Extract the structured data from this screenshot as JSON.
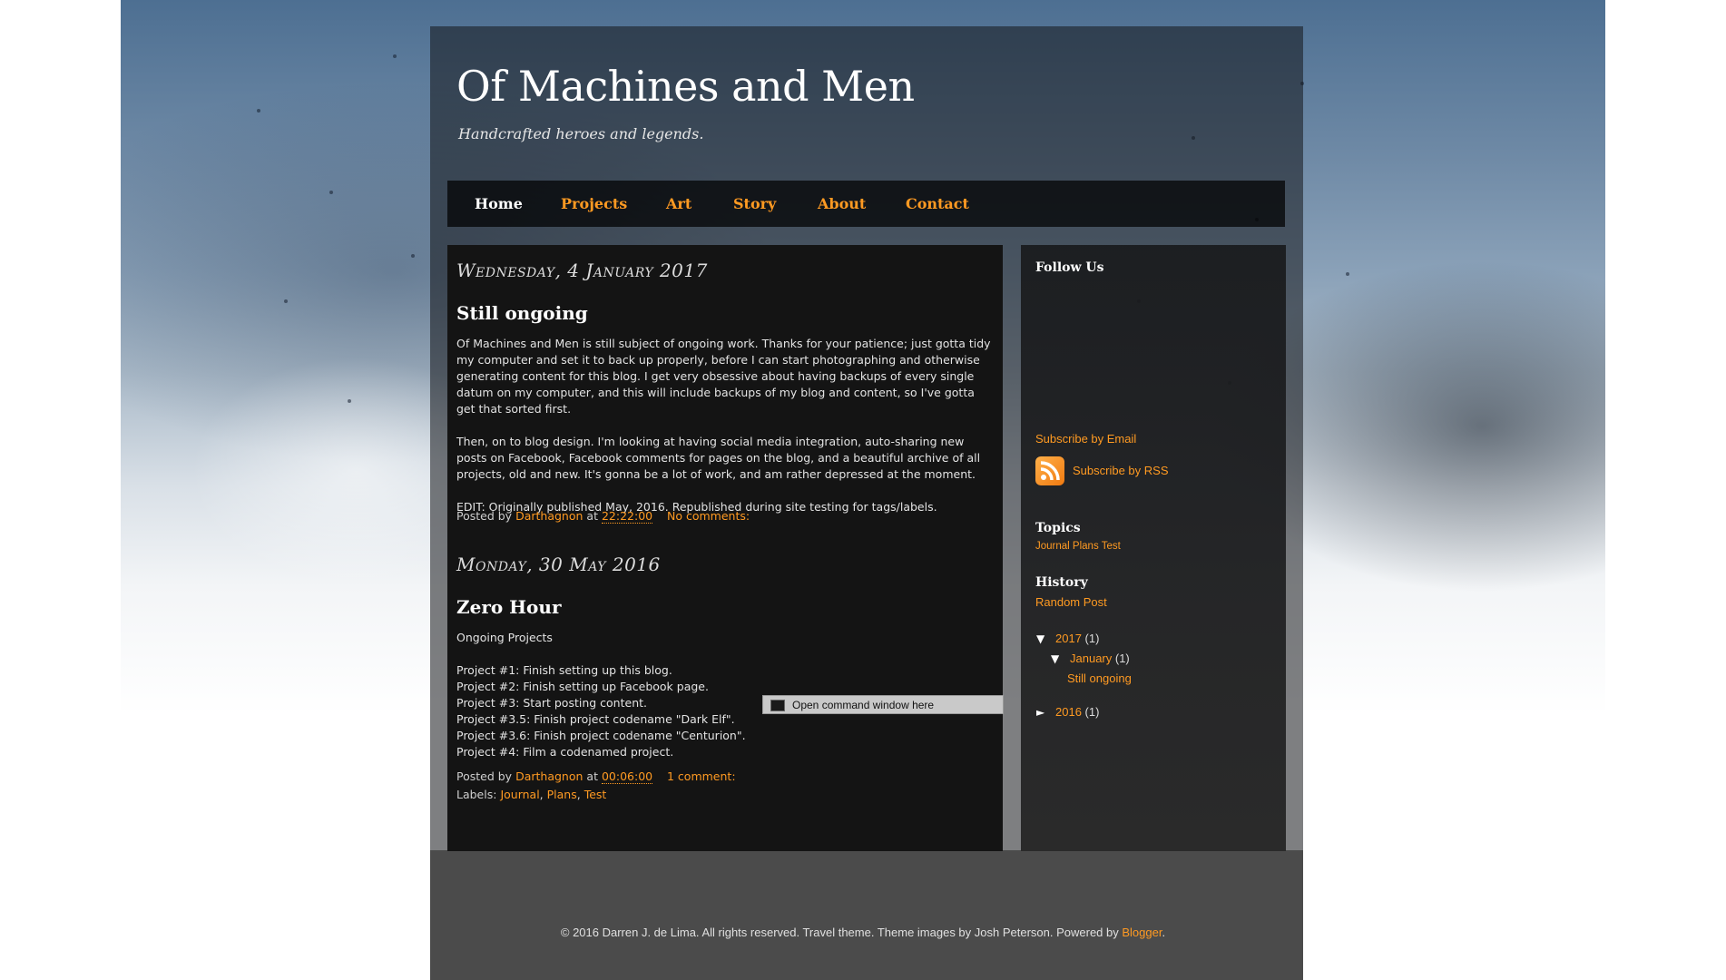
{
  "blog": {
    "title": "Of Machines and Men",
    "description": "Handcrafted heroes and legends."
  },
  "nav": {
    "items": [
      "Home",
      "Projects",
      "Art",
      "Story",
      "About",
      "Contact"
    ],
    "active": "Home"
  },
  "posts": [
    {
      "date": "Wednesday, 4 January 2017",
      "title": "Still ongoing",
      "paragraphs": [
        "Of Machines and Men is still subject of ongoing work. Thanks for your patience; just gotta tidy my computer and set it to back up properly, before I can start photographing and otherwise generating content for this blog. I get very obsessive about having backups of every single datum on my computer, and this will include backups of my blog and content, so I've gotta get that sorted first.",
        "Then, on to blog design. I'm looking at having social media integration, auto-sharing new posts on Facebook, Facebook comments for pages on the blog, and a beautiful archive of all projects, old and new. It's gonna be a lot of work, and am rather depressed at the moment.",
        "EDIT: Originally published May, 2016. Republished during site testing for tags/labels."
      ],
      "posted_by_label": "Posted by",
      "author": "Darthagnon",
      "at_label": "at",
      "time": "22:22:00",
      "comments": "No comments:"
    },
    {
      "date": "Monday, 30 May 2016",
      "title": "Zero Hour",
      "intro": "Ongoing Projects",
      "lines": [
        "Project #1: Finish setting up this blog.",
        "Project #2: Finish setting up Facebook page.",
        "Project #3: Start posting content.",
        "Project #3.5: Finish project codename \"Dark Elf\".",
        "Project #3.6: Finish project codename \"Centurion\".",
        "Project #4: Film a codenamed project."
      ],
      "posted_by_label": "Posted by",
      "author": "Darthagnon",
      "at_label": "at",
      "time": "00:06:00",
      "comments": "1 comment:",
      "labels_label": "Labels:",
      "labels": [
        "Journal",
        "Plans",
        "Test"
      ]
    }
  ],
  "tooltip": {
    "text": "Open command window here",
    "icon": "cmd-icon"
  },
  "sidebar": {
    "follow_title": "Follow Us",
    "subscribe_email": "Subscribe by Email",
    "subscribe_rss": "Subscribe by RSS",
    "rss_icon": "rss-icon",
    "topics_title": "Topics",
    "topics": [
      "Journal",
      "Plans",
      "Test"
    ],
    "history_title": "History",
    "random_post": "Random Post",
    "archive": {
      "year1": "2017",
      "year1_count": "(1)",
      "month1": "January",
      "month1_count": "(1)",
      "post1": "Still ongoing",
      "year2": "2016",
      "year2_count": "(1)",
      "expanded_glyph": "▼",
      "collapsed_glyph": "►"
    }
  },
  "footer": {
    "copyright": "© 2016 Darren J. de Lima. All rights reserved. Travel theme. Theme images by Josh Peterson. Powered by",
    "powered_link": "Blogger",
    "period": "."
  },
  "colors": {
    "accent": "#ff9a22",
    "panel": "#141414",
    "footer_bg": "#4b4b4b"
  }
}
